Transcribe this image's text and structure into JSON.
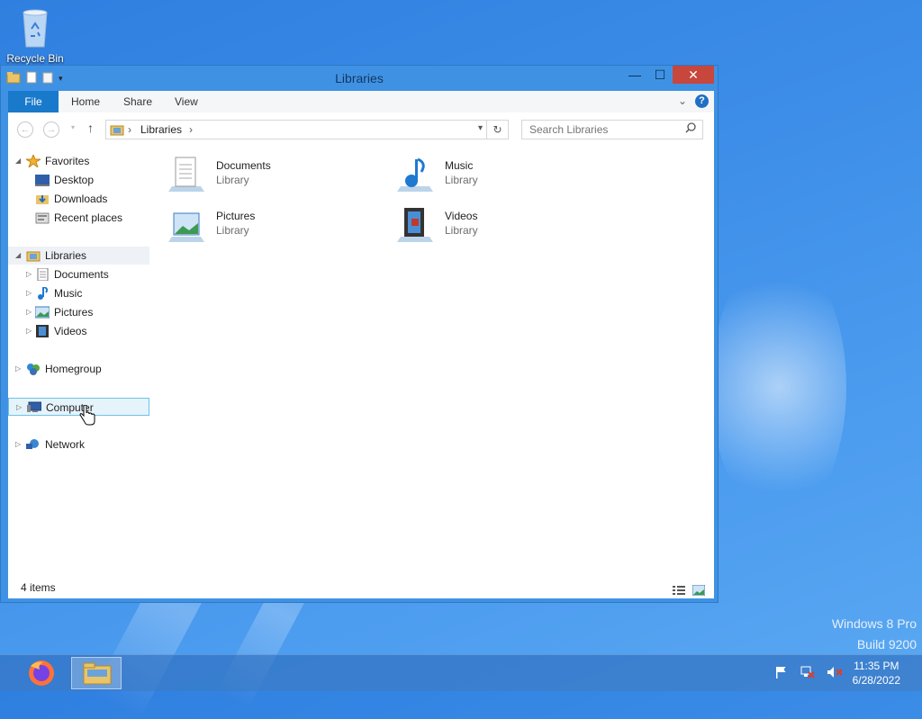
{
  "desktop": {
    "recycle_bin_label": "Recycle Bin"
  },
  "window": {
    "title": "Libraries",
    "controls": {
      "minimize": "—",
      "maximize": "☐",
      "close": "✕"
    },
    "ribbon": {
      "file": "File",
      "home": "Home",
      "share": "Share",
      "view": "View",
      "help": "?"
    },
    "address": {
      "crumb": "Libraries",
      "search_placeholder": "Search Libraries"
    },
    "nav": {
      "favorites": "Favorites",
      "desktop": "Desktop",
      "downloads": "Downloads",
      "recent": "Recent places",
      "libraries": "Libraries",
      "documents": "Documents",
      "music": "Music",
      "pictures": "Pictures",
      "videos": "Videos",
      "homegroup": "Homegroup",
      "computer": "Computer",
      "network": "Network"
    },
    "items": [
      {
        "name": "Documents",
        "type": "Library"
      },
      {
        "name": "Music",
        "type": "Library"
      },
      {
        "name": "Pictures",
        "type": "Library"
      },
      {
        "name": "Videos",
        "type": "Library"
      }
    ],
    "status": "4 items"
  },
  "watermark": {
    "line1": "Windows 8 Pro",
    "line2": "Build 9200"
  },
  "taskbar": {
    "time": "11:35 PM",
    "date": "6/28/2022"
  },
  "colors": {
    "accent": "#1979ca",
    "close": "#c7473d",
    "desktop": "#3d8ee8"
  }
}
